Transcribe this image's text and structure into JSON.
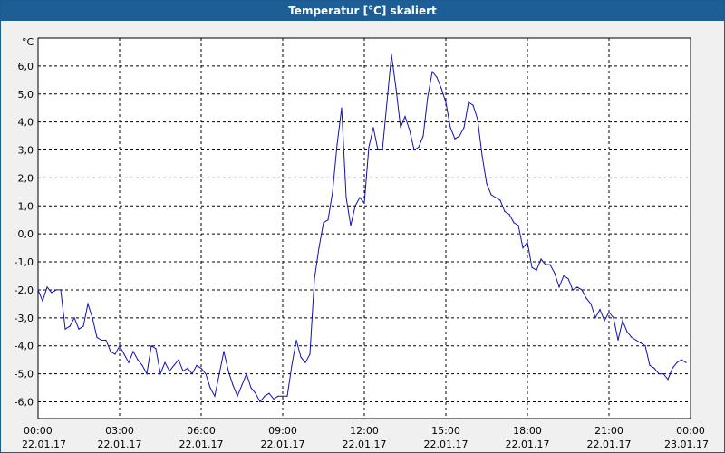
{
  "window": {
    "title": "Temperatur [°C] skaliert"
  },
  "colors": {
    "title_bar": "#1d5e97",
    "series_line": "#1010b0",
    "background": "#f0f0f0",
    "grid": "#000000"
  },
  "chart_data": {
    "type": "line",
    "title": "Temperatur [°C] skaliert",
    "ylabel": "°C",
    "xlabel": "",
    "grid": true,
    "ylim": [
      -6.6,
      7.0
    ],
    "xlim": [
      "2017-01-22 00:00",
      "2017-01-23 00:00"
    ],
    "y_ticks": [
      -6,
      -5,
      -4,
      -3,
      -2,
      -1,
      0,
      1,
      2,
      3,
      4,
      5,
      6
    ],
    "y_tick_labels": [
      "-6,0",
      "-5,0",
      "-4,0",
      "-3,0",
      "-2,0",
      "-1,0",
      "0,0",
      "1,0",
      "2,0",
      "3,0",
      "4,0",
      "5,0",
      "6,0"
    ],
    "x_ticks": [
      {
        "time": "00:00",
        "date": "22.01.17"
      },
      {
        "time": "03:00",
        "date": "22.01.17"
      },
      {
        "time": "06:00",
        "date": "22.01.17"
      },
      {
        "time": "09:00",
        "date": "22.01.17"
      },
      {
        "time": "12:00",
        "date": "22.01.17"
      },
      {
        "time": "15:00",
        "date": "22.01.17"
      },
      {
        "time": "18:00",
        "date": "22.01.17"
      },
      {
        "time": "21:00",
        "date": "22.01.17"
      },
      {
        "time": "00:00",
        "date": "23.01.17"
      }
    ],
    "series": [
      {
        "x": [
          "00:00",
          "00:10",
          "00:20",
          "00:30",
          "00:40",
          "00:50",
          "01:00",
          "01:10",
          "01:20",
          "01:30",
          "01:40",
          "01:50",
          "02:00",
          "02:10",
          "02:20",
          "02:30",
          "02:40",
          "02:50",
          "03:00",
          "03:10",
          "03:20",
          "03:30",
          "03:40",
          "03:50",
          "04:00",
          "04:10",
          "04:20",
          "04:30",
          "04:40",
          "04:50",
          "05:00",
          "05:10",
          "05:20",
          "05:30",
          "05:40",
          "05:50",
          "06:00",
          "06:10",
          "06:20",
          "06:30",
          "06:40",
          "06:50",
          "07:00",
          "07:10",
          "07:20",
          "07:30",
          "07:40",
          "07:50",
          "08:00",
          "08:10",
          "08:20",
          "08:30",
          "08:40",
          "08:50",
          "09:00",
          "09:10",
          "09:20",
          "09:30",
          "09:40",
          "09:50",
          "10:00",
          "10:10",
          "10:20",
          "10:30",
          "10:40",
          "10:50",
          "11:00",
          "11:10",
          "11:20",
          "11:30",
          "11:40",
          "11:50",
          "12:00",
          "12:10",
          "12:20",
          "12:30",
          "12:40",
          "12:50",
          "13:00",
          "13:10",
          "13:20",
          "13:30",
          "13:40",
          "13:50",
          "14:00",
          "14:10",
          "14:20",
          "14:30",
          "14:40",
          "14:50",
          "15:00",
          "15:10",
          "15:20",
          "15:30",
          "15:40",
          "15:50",
          "16:00",
          "16:10",
          "16:20",
          "16:30",
          "16:40",
          "16:50",
          "17:00",
          "17:10",
          "17:20",
          "17:30",
          "17:40",
          "17:50",
          "18:00",
          "18:10",
          "18:20",
          "18:30",
          "18:40",
          "18:50",
          "19:00",
          "19:10",
          "19:20",
          "19:30",
          "19:40",
          "19:50",
          "20:00",
          "20:10",
          "20:20",
          "20:30",
          "20:40",
          "20:50",
          "21:00",
          "21:10",
          "21:20",
          "21:30",
          "21:40",
          "21:50",
          "22:00",
          "22:10",
          "22:20",
          "22:30",
          "22:40",
          "22:50",
          "23:00",
          "23:10",
          "23:20",
          "23:30",
          "23:40",
          "23:50"
        ],
        "y": [
          -2.0,
          -2.4,
          -1.9,
          -2.1,
          -2.0,
          -2.0,
          -3.4,
          -3.3,
          -3.0,
          -3.4,
          -3.3,
          -2.5,
          -3.0,
          -3.7,
          -3.8,
          -3.8,
          -4.2,
          -4.3,
          -4.0,
          -4.3,
          -4.6,
          -4.2,
          -4.5,
          -4.7,
          -5.0,
          -4.0,
          -4.1,
          -5.0,
          -4.6,
          -4.9,
          -4.7,
          -4.5,
          -4.9,
          -4.8,
          -5.0,
          -4.7,
          -4.8,
          -5.0,
          -5.5,
          -5.8,
          -5.0,
          -4.2,
          -4.9,
          -5.4,
          -5.8,
          -5.4,
          -5.0,
          -5.5,
          -5.7,
          -6.0,
          -5.8,
          -5.7,
          -5.9,
          -5.8,
          -5.8,
          -5.8,
          -4.7,
          -3.8,
          -4.4,
          -4.6,
          -4.3,
          -1.6,
          -0.5,
          0.4,
          0.5,
          1.5,
          3.2,
          4.5,
          1.3,
          0.3,
          1.0,
          1.3,
          1.1,
          3.1,
          3.8,
          3.0,
          3.0,
          4.7,
          6.4,
          5.2,
          3.8,
          4.2,
          3.7,
          3.0,
          3.1,
          3.5,
          4.9,
          5.8,
          5.6,
          5.2,
          4.7,
          3.8,
          3.4,
          3.5,
          3.8,
          4.7,
          4.6,
          4.1,
          2.8,
          1.8,
          1.4,
          1.3,
          1.2,
          0.8,
          0.7,
          0.4,
          0.3,
          -0.5,
          -0.3,
          -1.2,
          -1.3,
          -0.9,
          -1.1,
          -1.1,
          -1.4,
          -1.9,
          -1.5,
          -1.6,
          -2.0,
          -1.9,
          -2.0,
          -2.3,
          -2.5,
          -3.0,
          -2.7,
          -3.1,
          -2.8,
          -3.0,
          -3.8,
          -3.1,
          -3.5,
          -3.7,
          -3.8,
          -3.9,
          -4.0,
          -4.7,
          -4.8,
          -5.0,
          -5.0,
          -5.2,
          -4.8,
          -4.6,
          -4.5,
          -4.6
        ]
      }
    ]
  }
}
